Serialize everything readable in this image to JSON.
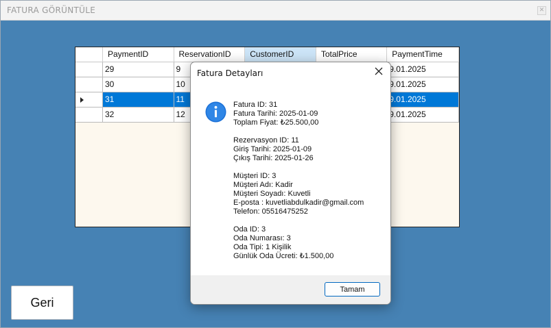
{
  "window": {
    "title": "FATURA GÖRÜNTÜLE",
    "close_glyph": "✕"
  },
  "grid": {
    "columns": [
      "PaymentID",
      "ReservationID",
      "CustomerID",
      "TotalPrice",
      "PaymentTime"
    ],
    "rows": [
      [
        "29",
        "9",
        "",
        "",
        "9.01.2025"
      ],
      [
        "30",
        "10",
        "",
        "",
        "9.01.2025"
      ],
      [
        "31",
        "11",
        "",
        "",
        "9.01.2025"
      ],
      [
        "32",
        "12",
        "",
        "",
        "9.01.2025"
      ]
    ]
  },
  "back_button": {
    "label": "Geri"
  },
  "dialog": {
    "title": "Fatura Detayları",
    "icon": "info-icon",
    "body": "Fatura ID: 31\nFatura Tarihi: 2025-01-09\nToplam Fiyat: ₺25.500,00\n\nRezervasyon ID: 11\nGiriş Tarihi: 2025-01-09\nÇıkış Tarihi: 2025-01-26\n\nMüşteri ID: 3\nMüşteri Adı: Kadir\nMüşteri Soyadı: Kuvetli\nE-posta : kuvetliabdulkadir@gmail.com\nTelefon: 05516475252\n\nOda ID: 3\nOda Numarası: 3\nOda Tipi: 1 Kişilik\nGünlük Oda Ücreti: ₺1.500,00",
    "ok_label": "Tamam"
  },
  "colors": {
    "background": "#4682b4",
    "selection": "#0078d7",
    "accent": "#0067c0"
  }
}
